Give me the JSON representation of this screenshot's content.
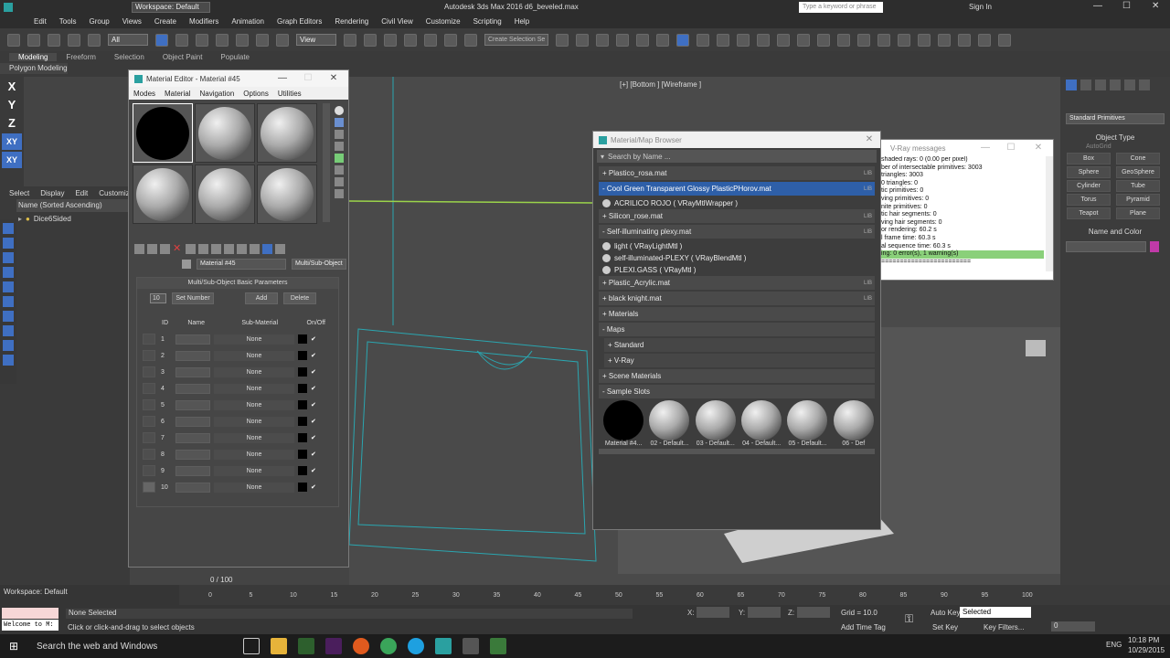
{
  "titlebar": {
    "workspace": "Workspace: Default",
    "title": "Autodesk 3ds Max 2016     d6_beveled.max",
    "search_placeholder": "Type a keyword or phrase",
    "sign_in": "Sign In"
  },
  "menubar": [
    "Edit",
    "Tools",
    "Group",
    "Views",
    "Create",
    "Modifiers",
    "Animation",
    "Graph Editors",
    "Rendering",
    "Civil View",
    "Customize",
    "Scripting",
    "Help"
  ],
  "toolbar": {
    "selection_filter": "All",
    "ref_coord": "View",
    "named_sel": "Create Selection Se"
  },
  "ribbon": {
    "tabs": [
      "Modeling",
      "Freeform",
      "Selection",
      "Object Paint",
      "Populate"
    ],
    "sub": "Polygon Modeling"
  },
  "axis_buttons": [
    "X",
    "Y",
    "Z",
    "XY",
    "XY"
  ],
  "scene_explorer": {
    "menus": [
      "Select",
      "Display",
      "Edit",
      "Customiz"
    ],
    "header": "Name (Sorted Ascending)",
    "items": [
      "Dice6Sided"
    ]
  },
  "material_editor": {
    "title": "Material Editor - Material #45",
    "menus": [
      "Modes",
      "Material",
      "Navigation",
      "Options",
      "Utilities"
    ],
    "material_name": "Material #45",
    "material_type": "Multi/Sub-Object",
    "rollout_title": "Multi/Sub-Object Basic Parameters",
    "count": "10",
    "buttons": {
      "set_number": "Set Number",
      "add": "Add",
      "delete": "Delete"
    },
    "columns": {
      "id": "ID",
      "name": "Name",
      "sub_material": "Sub-Material",
      "onoff": "On/Off"
    },
    "rows": [
      {
        "id": "1",
        "sub": "None"
      },
      {
        "id": "2",
        "sub": "None"
      },
      {
        "id": "3",
        "sub": "None"
      },
      {
        "id": "4",
        "sub": "None"
      },
      {
        "id": "5",
        "sub": "None"
      },
      {
        "id": "6",
        "sub": "None"
      },
      {
        "id": "7",
        "sub": "None"
      },
      {
        "id": "8",
        "sub": "None"
      },
      {
        "id": "9",
        "sub": "None"
      },
      {
        "id": "10",
        "sub": "None"
      }
    ]
  },
  "viewport": {
    "label": "[+] [Bottom ] [Wireframe ]"
  },
  "browser": {
    "title": "Material/Map Browser",
    "search": "Search by Name ...",
    "lib": "LIB",
    "groups": [
      {
        "name": "+ Plastico_rosa.mat",
        "lib": true,
        "sel": false,
        "items": []
      },
      {
        "name": "- Cool Green Transparent Glossy PlasticPHorov.mat",
        "lib": true,
        "sel": true,
        "items": [
          "ACRILICO ROJO  ( VRayMtlWrapper )"
        ]
      },
      {
        "name": "+ Silicon_rose.mat",
        "lib": true,
        "sel": false,
        "items": []
      },
      {
        "name": "- Self-illuminating plexy.mat",
        "lib": true,
        "sel": false,
        "items": [
          "light  ( VRayLightMtl )",
          "self-illuminated-PLEXY  ( VRayBlendMtl )",
          "PLEXI.GASS  ( VRayMtl )"
        ]
      },
      {
        "name": "+ Plastic_Acrylic.mat",
        "lib": true,
        "sel": false,
        "items": []
      },
      {
        "name": "+ black knight.mat",
        "lib": true,
        "sel": false,
        "items": []
      },
      {
        "name": "+ Materials",
        "lib": false,
        "sel": false,
        "items": []
      },
      {
        "name": "- Maps",
        "lib": false,
        "sel": false,
        "items": []
      },
      {
        "name": "+ Standard",
        "lib": false,
        "sel": false,
        "items": [],
        "indent": true
      },
      {
        "name": "+ V-Ray",
        "lib": false,
        "sel": false,
        "items": [],
        "indent": true
      },
      {
        "name": "+ Scene Materials",
        "lib": false,
        "sel": false,
        "items": []
      },
      {
        "name": "- Sample Slots",
        "lib": false,
        "sel": false,
        "items": []
      }
    ],
    "slots": [
      "Material #4...",
      "02 - Default...",
      "03 - Default...",
      "04 - Default...",
      "05 - Default...",
      "06 - Def"
    ]
  },
  "vray": {
    "title": "V-Ray messages",
    "lines": [
      "shaded rays: 0 (0.00 per pixel)",
      "ber of intersectable primitives: 3003",
      "triangles: 3003",
      "0 triangles: 0",
      "tic primitives: 0",
      "ving primitives: 0",
      "nite primitives: 0",
      "tic hair segments: 0",
      "ving hair segments: 0",
      "or rendering: 60.2 s",
      "l frame time: 60.3 s",
      "al sequence time: 60.3 s",
      "ing: 0 error(s), 1 warning(s)",
      "========================"
    ]
  },
  "cmd_panel": {
    "dropdown": "Standard Primitives",
    "rollout_object": "Object Type",
    "autogrid": "AutoGrid",
    "buttons": [
      "Box",
      "Cone",
      "Sphere",
      "GeoSphere",
      "Cylinder",
      "Tube",
      "Torus",
      "Pyramid",
      "Teapot",
      "Plane"
    ],
    "rollout_name": "Name and Color"
  },
  "trackbar": {
    "frame": "0 / 100",
    "ticks": [
      "0",
      "5",
      "10",
      "15",
      "20",
      "25",
      "30",
      "35",
      "40",
      "45",
      "50",
      "55",
      "60",
      "65",
      "70",
      "75",
      "80",
      "85",
      "90",
      "95",
      "100"
    ]
  },
  "status": {
    "workspace": "Workspace: Default",
    "maxscript": "Welcome to M:",
    "selection": "None Selected",
    "prompt": "Click or click-and-drag to select objects",
    "x": "X:",
    "y": "Y:",
    "z": "Z:",
    "grid": "Grid = 10.0",
    "add_time_tag": "Add Time Tag",
    "auto_key": "Auto Key",
    "selected": "Selected",
    "set_key": "Set Key",
    "key_filters": "Key Filters...",
    "frame": "0"
  },
  "taskbar": {
    "search": "Search the web and Windows",
    "lang": "ENG",
    "time": "10:18 PM",
    "date": "10/29/2015"
  }
}
